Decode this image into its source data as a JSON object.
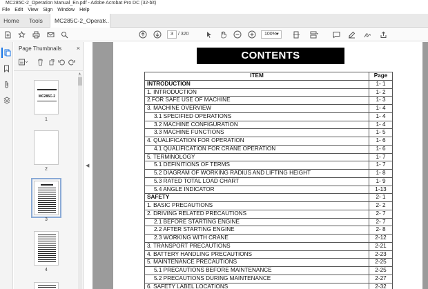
{
  "window": {
    "title": "MC285C-2_Operation Manual_En.pdf - Adobe Acrobat Pro DC (32-bit)"
  },
  "menu": [
    "File",
    "Edit",
    "View",
    "Sign",
    "Window",
    "Help"
  ],
  "tabs": {
    "home": "Home",
    "tools": "Tools",
    "doc": "MC285C-2_Operat...",
    "doc_close": "×"
  },
  "toolbar": {
    "page_current": "3",
    "page_total": "/ 320",
    "zoom": "100%",
    "icons": [
      "create-icon",
      "bookmark-star-icon",
      "print-icon",
      "mail-icon",
      "search-icon",
      "prev-page-icon",
      "next-page-icon",
      "select-cursor-icon",
      "hand-icon",
      "zoom-out-icon",
      "zoom-in-icon",
      "fit-page-icon",
      "scroll-mode-icon",
      "comment-icon",
      "highlight-pen-icon",
      "sign-icon",
      "share-icon"
    ]
  },
  "thumb_panel": {
    "title": "Page Thumbnails",
    "close": "×",
    "thumbnails": [
      {
        "num": "1",
        "cover_title": "MC285C-2"
      },
      {
        "num": "2"
      },
      {
        "num": "3"
      },
      {
        "num": "4"
      }
    ]
  },
  "document": {
    "banner": "CONTENTS",
    "header": {
      "item": "ITEM",
      "page": "Page"
    },
    "rows": [
      {
        "text": "INTRODUCTION",
        "page": "1- 1",
        "style": "bold"
      },
      {
        "text": "1. INTRODUCTION",
        "page": "1- 2",
        "style": "normal"
      },
      {
        "text": "2.FOR SAFE USE OF MACHINE",
        "page": "1- 3",
        "style": "normal"
      },
      {
        "text": "3. MACHINE OVERVIEW",
        "page": "1- 4",
        "style": "normal"
      },
      {
        "text": "3.1 SPECIFIED OPERATIONS",
        "page": "1- 4",
        "style": "sub"
      },
      {
        "text": "3.2 MACHINE CONFIGURATION",
        "page": "1- 4",
        "style": "sub"
      },
      {
        "text": "3.3 MACHINE FUNCTIONS",
        "page": "1- 5",
        "style": "sub"
      },
      {
        "text": "4. QUALIFICATION FOR OPERATION",
        "page": "1- 6",
        "style": "normal"
      },
      {
        "text": "4.1 QUALIFICATION FOR CRANE OPERATION",
        "page": "1- 6",
        "style": "sub"
      },
      {
        "text": "5. TERMINOLOGY",
        "page": "1- 7",
        "style": "normal"
      },
      {
        "text": "5.1 DEFINITIONS OF TERMS",
        "page": "1- 7",
        "style": "sub"
      },
      {
        "text": "5.2 DIAGRAM OF WORKING RADIUS AND LIFTING HEIGHT",
        "page": "1- 8",
        "style": "sub"
      },
      {
        "text": "5.3 RATED TOTAL LOAD CHART",
        "page": "1- 9",
        "style": "sub"
      },
      {
        "text": "5.4 ANGLE INDICATOR",
        "page": "1-13",
        "style": "sub"
      },
      {
        "text": "SAFETY",
        "page": "2- 1",
        "style": "bold"
      },
      {
        "text": "1. BASIC PRECAUTIONS",
        "page": "2- 2",
        "style": "normal"
      },
      {
        "text": "2. DRIVING RELATED PRECAUTIONS",
        "page": "2- 7",
        "style": "normal"
      },
      {
        "text": "2.1 BEFORE STARTING ENGINE",
        "page": "2- 7",
        "style": "sub"
      },
      {
        "text": "2.2 AFTER STARTING ENGINE",
        "page": "2- 8",
        "style": "sub"
      },
      {
        "text": "2.3 WORKING WITH CRANE",
        "page": "2-12",
        "style": "sub"
      },
      {
        "text": "3. TRANSPORT PRECAUTIONS",
        "page": "2-21",
        "style": "normal"
      },
      {
        "text": "4. BATTERY HANDLING PRECAUTIONS",
        "page": "2-23",
        "style": "normal"
      },
      {
        "text": "5. MAINTENANCE PRECAUTIONS",
        "page": "2-25",
        "style": "normal"
      },
      {
        "text": "5.1 PRECAUTIONS BEFORE MAINTENANCE",
        "page": "2-25",
        "style": "sub"
      },
      {
        "text": "5.2 PRECAUTIONS DURING MAINTENANCE",
        "page": "2-27",
        "style": "sub"
      },
      {
        "text": "6. SAFETY LABEL LOCATIONS",
        "page": "2-32",
        "style": "normal"
      }
    ]
  }
}
